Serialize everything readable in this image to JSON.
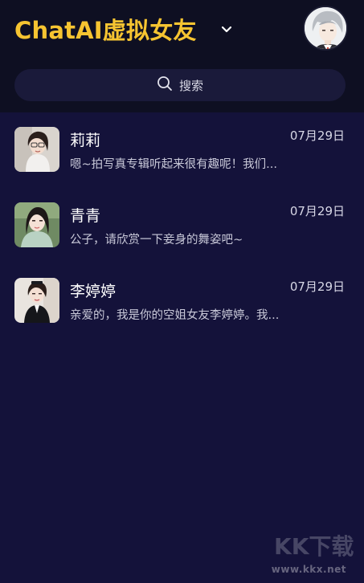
{
  "header": {
    "title": "ChatAI虚拟女友",
    "dropdown_icon": "chevron-down-icon",
    "avatar_icon": "user-avatar-icon",
    "title_color": "#f6c431",
    "background": "#0e0f22"
  },
  "search": {
    "label": "搜索",
    "icon": "search-icon"
  },
  "chats": [
    {
      "name": "莉莉",
      "date": "07月29日",
      "preview": "嗯~拍写真专辑听起来很有趣呢！我们..."
    },
    {
      "name": "青青",
      "date": "07月29日",
      "preview": "公子，请欣赏一下妾身的舞姿吧~"
    },
    {
      "name": "李婷婷",
      "date": "07月29日",
      "preview": "亲爱的，我是你的空姐女友李婷婷。我..."
    }
  ],
  "watermark": {
    "text": "www.kkx.net",
    "logo_text": "KK下载"
  },
  "colors": {
    "page_background": "#14123a",
    "search_background": "#1a1a3a"
  }
}
